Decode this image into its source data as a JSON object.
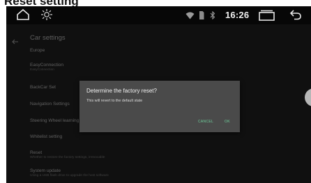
{
  "caption": "Reset setting",
  "status_bar": {
    "time": "16:26",
    "icons": [
      "home-icon",
      "brightness-icon",
      "wifi-icon",
      "sim-icon",
      "bluetooth-icon",
      "recent-apps-icon",
      "back-icon"
    ]
  },
  "page": {
    "title": "Car settings",
    "rows": [
      {
        "title": "Europe",
        "subtitle": ""
      },
      {
        "title": "EasyConnection",
        "subtitle": "EasyConnection"
      },
      {
        "title": "BackCar Set",
        "subtitle": ""
      },
      {
        "title": "Navigation Settings",
        "subtitle": ""
      },
      {
        "title": "Steering Wheel learning",
        "subtitle": ""
      },
      {
        "title": "Whitelist setting",
        "subtitle": ""
      },
      {
        "title": "Reset",
        "subtitle": "Whether to restore the factory settings, irrevocable"
      },
      {
        "title": "System update",
        "subtitle": "Using a USB flash drive to upgrade the host software"
      }
    ]
  },
  "dialog": {
    "title": "Determine the factory reset?",
    "message": "This will revert to the default state",
    "cancel_label": "CANCEL",
    "ok_label": "OK"
  },
  "colors": {
    "accent": "#6fcf9c",
    "dialog_bg": "#4a4a4a",
    "screen_bg": "#151515"
  }
}
